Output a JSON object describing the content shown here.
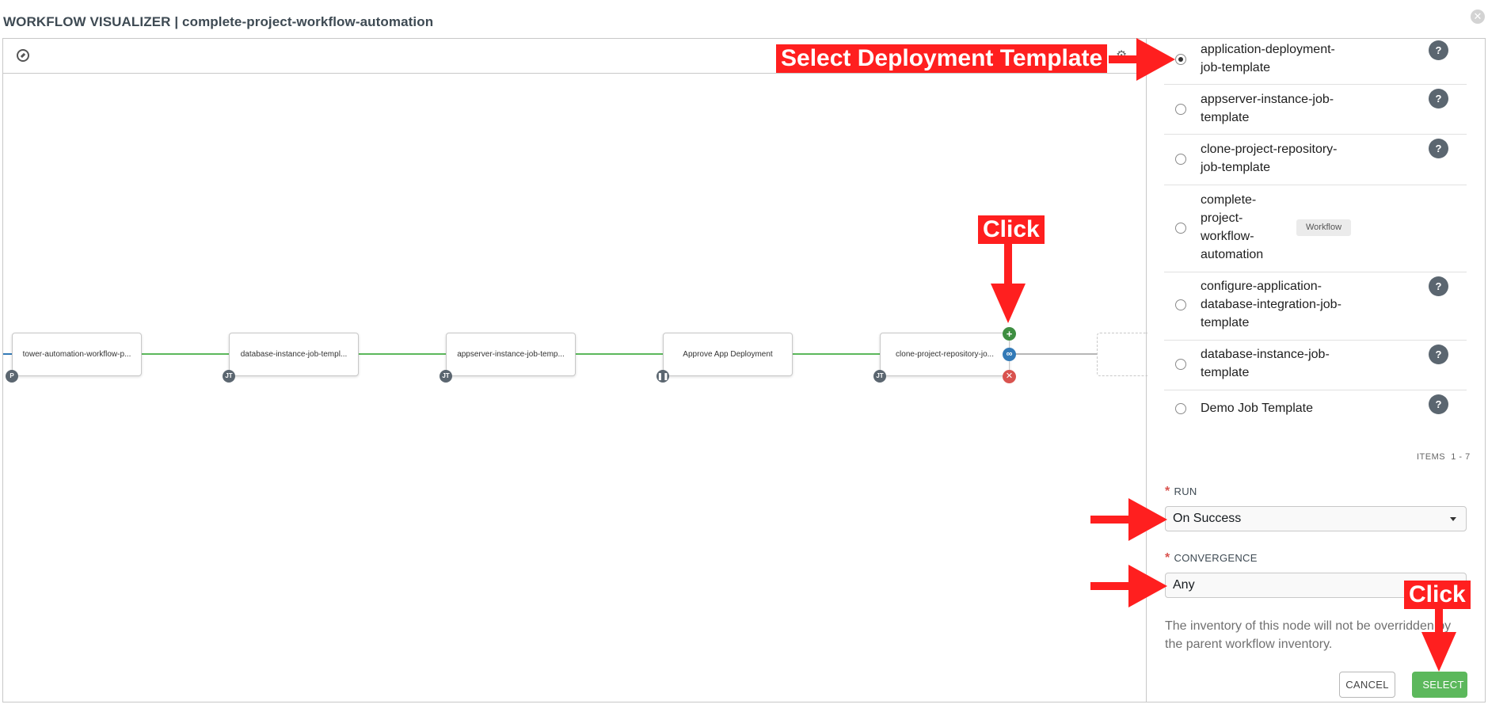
{
  "header": {
    "title": "WORKFLOW VISUALIZER | complete-project-workflow-automation"
  },
  "canvas": {
    "nodes": [
      {
        "label": "tower-automation-workflow-p...",
        "badge": "P"
      },
      {
        "label": "database-instance-job-templ...",
        "badge": "JT"
      },
      {
        "label": "appserver-instance-job-temp...",
        "badge": "JT"
      },
      {
        "label": "Approve App Deployment",
        "badge": "pause"
      },
      {
        "label": "clone-project-repository-jo...",
        "badge": "JT"
      }
    ],
    "node_actions": {
      "add_icon": "+",
      "link_icon": "⛓",
      "delete_icon": "✕"
    }
  },
  "panel": {
    "templates": [
      {
        "name_line1": "application-deployment-",
        "name_line2": "job-template",
        "selected": true,
        "help": "?"
      },
      {
        "name_line1": "appserver-instance-job-",
        "name_line2": "template",
        "selected": false,
        "help": "?"
      },
      {
        "name_line1": "clone-project-repository-",
        "name_line2": "job-template",
        "selected": false,
        "help": "?"
      },
      {
        "name_line1": "complete-",
        "name_line2": "project-",
        "name_line3": "workflow-",
        "name_line4": "automation",
        "tag": "Workflow",
        "selected": false
      },
      {
        "name_line1": "configure-application-",
        "name_line2": "database-integration-job-",
        "name_line3": "template",
        "selected": false,
        "help": "?"
      },
      {
        "name_line1": "database-instance-job-",
        "name_line2": "template",
        "selected": false,
        "help": "?"
      },
      {
        "name_line1": "Demo Job Template",
        "selected": false,
        "help": "?"
      }
    ],
    "items_count": "ITEMS  1 - 7",
    "run": {
      "label": "RUN",
      "required_mark": "*",
      "value": "On Success"
    },
    "convergence": {
      "label": "CONVERGENCE",
      "required_mark": "*",
      "value": "Any"
    },
    "help_text": "The inventory of this node will not be overridden by the parent workflow inventory.",
    "buttons": {
      "cancel": "CANCEL",
      "select": "SELECT"
    }
  },
  "annotations": {
    "select_template": "Select Deployment Template",
    "click_add": "Click",
    "click_select": "Click"
  },
  "colors": {
    "success_green": "#5cb85c",
    "annotation_red": "#ff1f1f",
    "link_blue": "#337ab7",
    "delete_red": "#d9534f",
    "badge_grey": "#5b6670"
  }
}
